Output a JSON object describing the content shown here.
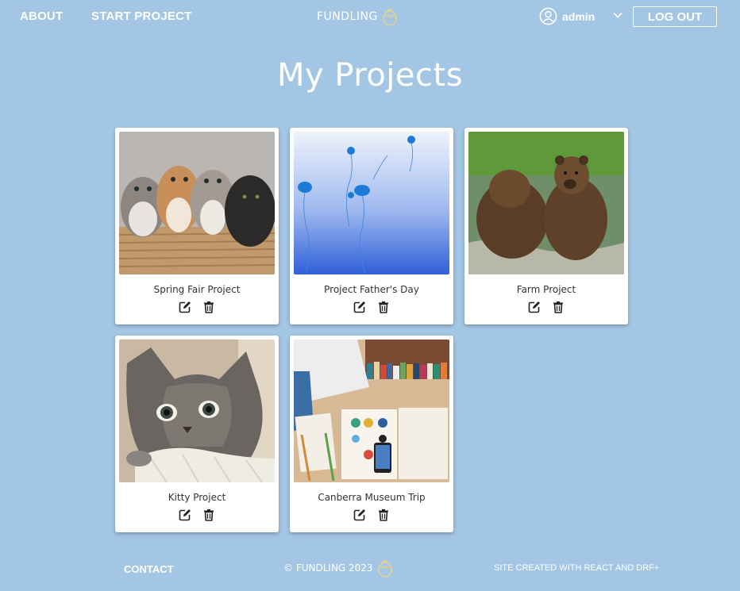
{
  "nav": {
    "about": "ABOUT",
    "start_project": "START PROJECT",
    "logo": "FUNDLING",
    "user": "admin",
    "logout": "LOG OUT"
  },
  "page": {
    "title": "My Projects"
  },
  "projects": [
    {
      "title": "Spring Fair Project",
      "image": "kittens-in-basket"
    },
    {
      "title": "Project Father's Day",
      "image": "jellyfish"
    },
    {
      "title": "Farm Project",
      "image": "bears-in-water"
    },
    {
      "title": "Kitty Project",
      "image": "kitten"
    },
    {
      "title": "Canberra Museum Trip",
      "image": "desk-with-books"
    }
  ],
  "footer": {
    "contact": "CONTACT",
    "copyright": "© FUNDLING 2023",
    "credit": "SITE CREATED WITH REACT AND DRF+"
  },
  "colors": {
    "background": "#a4c6e5",
    "card": "#ffffff",
    "text": "#333333"
  },
  "icons": [
    "egg-icon",
    "user-circle-icon",
    "chevron-down-icon",
    "edit-icon",
    "trash-icon"
  ]
}
